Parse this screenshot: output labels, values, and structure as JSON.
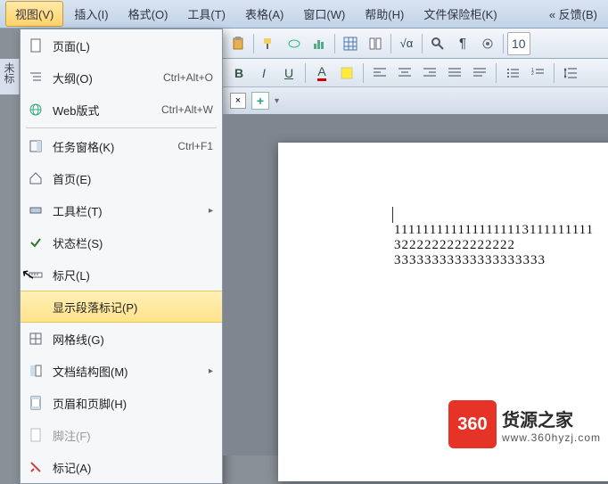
{
  "menubar": {
    "items": [
      {
        "label": "视图(V)",
        "active": true
      },
      {
        "label": "插入(I)"
      },
      {
        "label": "格式(O)"
      },
      {
        "label": "工具(T)"
      },
      {
        "label": "表格(A)"
      },
      {
        "label": "窗口(W)"
      },
      {
        "label": "帮助(H)"
      },
      {
        "label": "文件保险柜(K)"
      }
    ],
    "back": "« 反馈(B)"
  },
  "dropdown": {
    "items": [
      {
        "icon": "page-icon",
        "label": "页面(L)"
      },
      {
        "icon": "outline-icon",
        "label": "大纲(O)",
        "shortcut": "Ctrl+Alt+O"
      },
      {
        "icon": "web-icon",
        "label": "Web版式",
        "shortcut": "Ctrl+Alt+W"
      },
      {
        "sep": true
      },
      {
        "icon": "taskpane-icon",
        "label": "任务窗格(K)",
        "shortcut": "Ctrl+F1"
      },
      {
        "icon": "home-icon",
        "label": "首页(E)"
      },
      {
        "icon": "toolbar-icon",
        "label": "工具栏(T)",
        "submenu": true
      },
      {
        "icon": "check-icon",
        "label": "状态栏(S)"
      },
      {
        "icon": "ruler-icon",
        "label": "标尺(L)"
      },
      {
        "icon": "para-icon",
        "label": "显示段落标记(P)",
        "highlighted": true
      },
      {
        "icon": "grid-icon",
        "label": "网格线(G)"
      },
      {
        "icon": "docmap-icon",
        "label": "文档结构图(M)",
        "submenu": true
      },
      {
        "icon": "headerfooter-icon",
        "label": "页眉和页脚(H)"
      },
      {
        "icon": "footnote-icon",
        "label": "脚注(F)",
        "disabled": true
      },
      {
        "icon": "markup-icon",
        "label": "标记(A)"
      }
    ]
  },
  "left_panel": "未标",
  "document": {
    "lines": [
      "1111111111111111113111111111",
      "3222222222222222",
      "33333333333333333333"
    ]
  },
  "watermark": {
    "badge": "360",
    "title": "货源之家",
    "sub": "www.360hyzj.com"
  },
  "toolbar_right_value": "10"
}
